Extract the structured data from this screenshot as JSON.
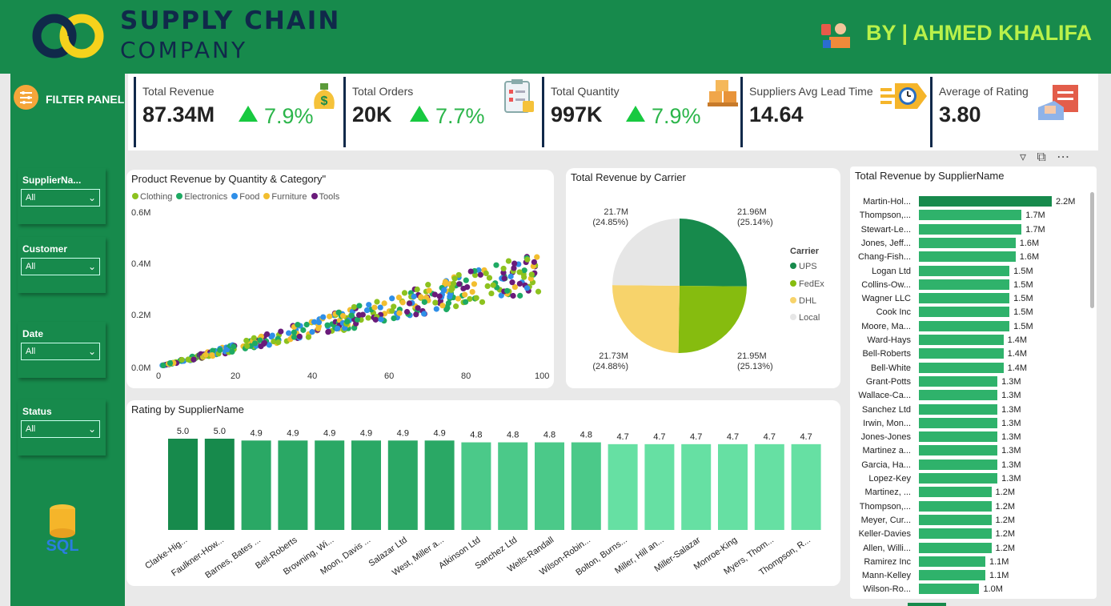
{
  "header": {
    "brand_line1": "SUPPLY CHAIN",
    "brand_line2": "COMPANY",
    "author": "BY | AHMED KHALIFA"
  },
  "sidebar": {
    "title": "FILTER PANEL",
    "filters": [
      {
        "label": "SupplierNa...",
        "value": "All"
      },
      {
        "label": "Customer",
        "value": "All"
      },
      {
        "label": "Date",
        "value": "All"
      },
      {
        "label": "Status",
        "value": "All"
      }
    ],
    "sql_label": "SQL"
  },
  "kpis": [
    {
      "title": "Total Revenue",
      "value": "87.34M",
      "delta": "7.9%",
      "icon": "money-bag-icon"
    },
    {
      "title": "Total Orders",
      "value": "20K",
      "delta": "7.7%",
      "icon": "clipboard-icon"
    },
    {
      "title": "Total Quantity",
      "value": "997K",
      "delta": "7.9%",
      "icon": "boxes-icon"
    },
    {
      "title": "Suppliers Avg Lead Time",
      "value": "14.64",
      "icon": "fast-clock-icon"
    },
    {
      "title": "Average of Rating",
      "value": "3.80",
      "icon": "rating-box-icon"
    }
  ],
  "scatter": {
    "title": "Product Revenue by Quantity & Category\"",
    "legend": [
      {
        "name": "Clothing",
        "color": "#8dc21f"
      },
      {
        "name": "Electronics",
        "color": "#1eaa63"
      },
      {
        "name": "Food",
        "color": "#2f8fe8"
      },
      {
        "name": "Furniture",
        "color": "#f2be2f"
      },
      {
        "name": "Tools",
        "color": "#6a1b7a"
      }
    ],
    "y_ticks": [
      "0.6M",
      "0.4M",
      "0.2M",
      "0.0M"
    ],
    "x_ticks": [
      "0",
      "20",
      "40",
      "60",
      "80",
      "100"
    ]
  },
  "chart_data": [
    {
      "type": "scatter",
      "title": "Product Revenue by Quantity & Category\"",
      "xlim": [
        0,
        100
      ],
      "ylim": [
        0,
        0.6
      ],
      "series": [
        {
          "name": "Clothing",
          "trend": "y ≈ 0.0036·x (M)"
        },
        {
          "name": "Electronics",
          "trend": "y ≈ 0.0036·x (M)"
        },
        {
          "name": "Food",
          "trend": "y ≈ 0.0036·x (M)"
        },
        {
          "name": "Furniture",
          "trend": "y ≈ 0.0036·x (M)"
        },
        {
          "name": "Tools",
          "trend": "y ≈ 0.0036·x (M)"
        }
      ]
    },
    {
      "type": "pie",
      "title": "Total Revenue by Carrier",
      "legend_title": "Carrier",
      "slices": [
        {
          "name": "UPS",
          "value": 21.96,
          "label": "21.96M",
          "pct": "(25.14%)",
          "color": "#178a4c"
        },
        {
          "name": "FedEx",
          "value": 21.95,
          "label": "21.95M",
          "pct": "(25.13%)",
          "color": "#86bc0f"
        },
        {
          "name": "DHL",
          "value": 21.73,
          "label": "21.73M",
          "pct": "(24.88%)",
          "color": "#f7d36b"
        },
        {
          "name": "Local",
          "value": 21.7,
          "label": "21.7M",
          "pct": "(24.85%)",
          "color": "#e6e6e6"
        }
      ]
    },
    {
      "type": "bar",
      "title": "Rating by SupplierName",
      "categories": [
        "Clarke-Hig...",
        "Faulkner-How...",
        "Barnes, Bates ...",
        "Bell-Roberts",
        "Browning, Wi...",
        "Moon, Davis ...",
        "Salazar Ltd",
        "West, Miller a...",
        "Atkinson Ltd",
        "Sanchez Ltd",
        "Wells-Randall",
        "Wilson-Robin...",
        "Bolton, Burns...",
        "Miller, Hill an...",
        "Miller-Salazar",
        "Monroe-King",
        "Myers, Thom...",
        "Thompson, R..."
      ],
      "values": [
        5.0,
        5.0,
        4.9,
        4.9,
        4.9,
        4.9,
        4.9,
        4.9,
        4.8,
        4.8,
        4.8,
        4.8,
        4.7,
        4.7,
        4.7,
        4.7,
        4.7,
        4.7
      ],
      "labels": [
        "5.0",
        "5.0",
        "4.9",
        "4.9",
        "4.9",
        "4.9",
        "4.9",
        "4.9",
        "4.8",
        "4.8",
        "4.8",
        "4.8",
        "4.7",
        "4.7",
        "4.7",
        "4.7",
        "4.7",
        "4.7"
      ]
    },
    {
      "type": "bar",
      "orientation": "horizontal",
      "title": "Total Revenue by SupplierName",
      "categories": [
        "Martin-Hol...",
        "Thompson,...",
        "Stewart-Le...",
        "Jones, Jeff...",
        "Chang-Fish...",
        "Logan Ltd",
        "Collins-Ow...",
        "Wagner LLC",
        "Cook Inc",
        "Moore, Ma...",
        "Ward-Hays",
        "Bell-Roberts",
        "Bell-White",
        "Grant-Potts",
        "Wallace-Ca...",
        "Sanchez Ltd",
        "Irwin, Mon...",
        "Jones-Jones",
        "Martinez a...",
        "Garcia, Ha...",
        "Lopez-Key",
        "Martinez, ...",
        "Thompson,...",
        "Meyer, Cur...",
        "Keller-Davies",
        "Allen, Willi...",
        "Ramirez Inc",
        "Mann-Kelley",
        "Wilson-Ro..."
      ],
      "values": [
        2.2,
        1.7,
        1.7,
        1.6,
        1.6,
        1.5,
        1.5,
        1.5,
        1.5,
        1.5,
        1.4,
        1.4,
        1.4,
        1.3,
        1.3,
        1.3,
        1.3,
        1.3,
        1.3,
        1.3,
        1.3,
        1.2,
        1.2,
        1.2,
        1.2,
        1.2,
        1.1,
        1.1,
        1.0
      ],
      "labels": [
        "2.2M",
        "1.7M",
        "1.7M",
        "1.6M",
        "1.6M",
        "1.5M",
        "1.5M",
        "1.5M",
        "1.5M",
        "1.5M",
        "1.4M",
        "1.4M",
        "1.4M",
        "1.3M",
        "1.3M",
        "1.3M",
        "1.3M",
        "1.3M",
        "1.3M",
        "1.3M",
        "1.3M",
        "1.2M",
        "1.2M",
        "1.2M",
        "1.2M",
        "1.2M",
        "1.1M",
        "1.1M",
        "1.0M"
      ]
    }
  ]
}
